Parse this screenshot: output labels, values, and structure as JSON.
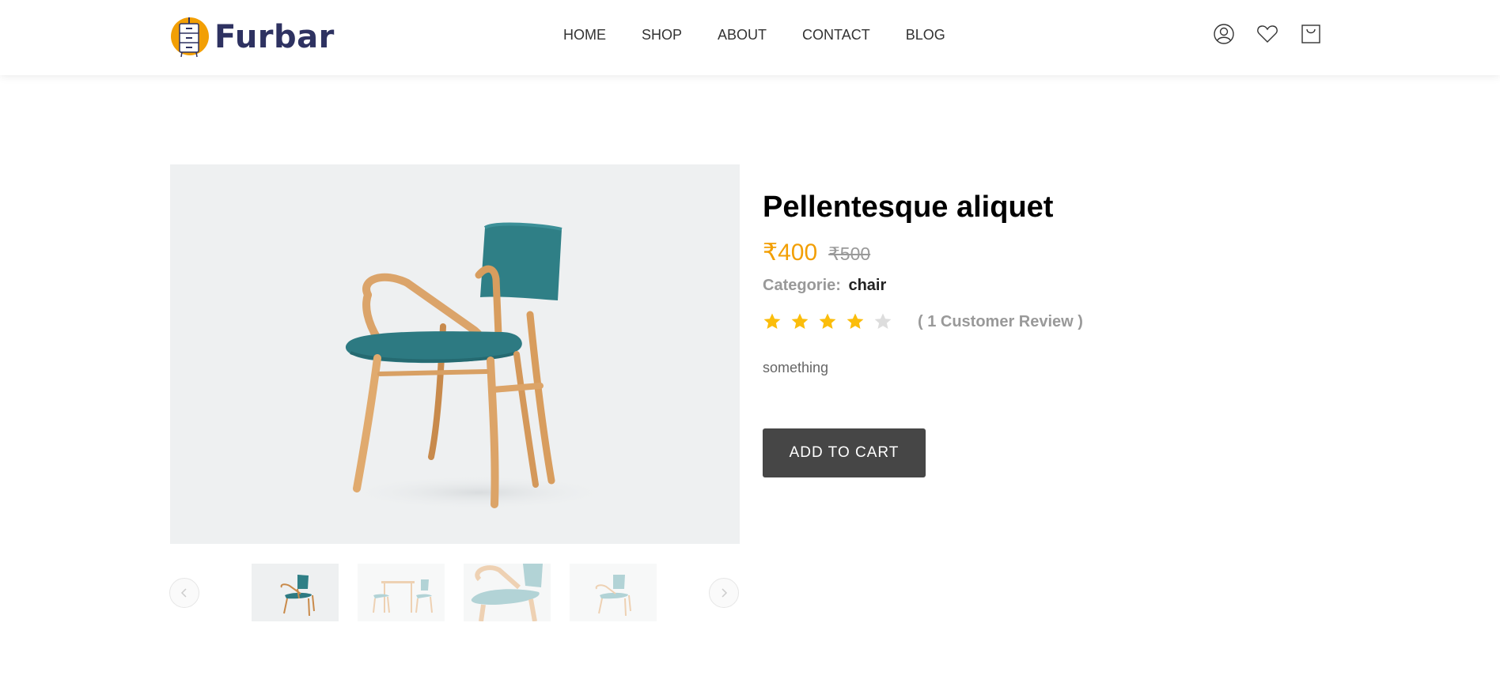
{
  "brand": {
    "name": "Furbar",
    "logo_icon": "dresser-logo-icon",
    "accent": "#f29f05"
  },
  "nav": {
    "items": [
      "HOME",
      "SHOP",
      "ABOUT",
      "CONTACT",
      "BLOG"
    ]
  },
  "header_icons": [
    "user-icon",
    "heart-icon",
    "cart-icon"
  ],
  "product": {
    "title": "Pellentesque aliquet",
    "price": "₹400",
    "old_price": "₹500",
    "category_label": "Categorie:",
    "category": "chair",
    "rating": 4,
    "rating_max": 5,
    "review_text": "( 1 Customer Review )",
    "description": "something",
    "add_to_cart": "ADD TO CART"
  },
  "gallery": {
    "thumbnails": [
      "chair-side-view",
      "chairs-with-table",
      "chair-closeup",
      "chair-front-view"
    ],
    "prev_icon": "chevron-left-icon",
    "next_icon": "chevron-right-icon"
  },
  "colors": {
    "star_on": "#fbbd0b",
    "star_off": "#dddddd",
    "button": "#464646",
    "title": "#000000"
  }
}
